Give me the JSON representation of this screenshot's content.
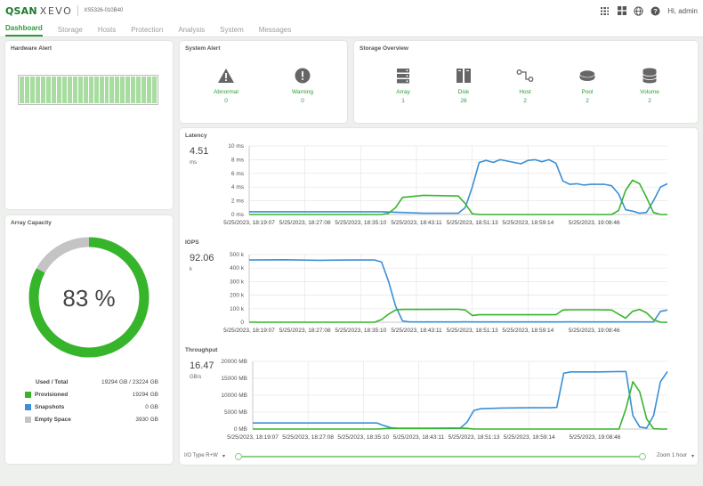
{
  "header": {
    "brand_main": "QSAN",
    "brand_sub": "XEVO",
    "model": "XS5326-010B40",
    "user_greeting": "Hi, admin",
    "icons": [
      "network-icon",
      "grid-icon",
      "globe-icon",
      "help-icon"
    ]
  },
  "nav": {
    "tabs": [
      {
        "label": "Dashboard",
        "active": true
      },
      {
        "label": "Storage",
        "active": false
      },
      {
        "label": "Hosts",
        "active": false
      },
      {
        "label": "Protection",
        "active": false
      },
      {
        "label": "Analysis",
        "active": false
      },
      {
        "label": "System",
        "active": false
      },
      {
        "label": "Messages",
        "active": false
      }
    ]
  },
  "hardware_alert": {
    "title": "Hardware Alert",
    "cell_count": 26
  },
  "system_alert": {
    "title": "System Alert",
    "items": [
      {
        "label": "Abnormal",
        "value": "0",
        "icon": "warning-triangle-icon"
      },
      {
        "label": "Warning",
        "value": "0",
        "icon": "alert-circle-icon"
      }
    ]
  },
  "storage_overview": {
    "title": "Storage Overview",
    "items": [
      {
        "label": "Array",
        "value": "1",
        "icon": "array-icon"
      },
      {
        "label": "Disk",
        "value": "26",
        "icon": "disk-icon"
      },
      {
        "label": "Host",
        "value": "2",
        "icon": "host-icon"
      },
      {
        "label": "Pool",
        "value": "2",
        "icon": "pool-icon"
      },
      {
        "label": "Volume",
        "value": "2",
        "icon": "volume-icon"
      }
    ]
  },
  "array_capacity": {
    "title": "Array Capacity",
    "percent_label": "83 %",
    "provisioned_fraction": 0.83,
    "used_total_label": "Used / Total",
    "used_total_value": "19294 GB / 23224 GB",
    "legend": [
      {
        "label": "Provisioned",
        "value": "19294 GB",
        "color": "#36b52b"
      },
      {
        "label": "Snapshots",
        "value": "0 GB",
        "color": "#3a8fd6"
      },
      {
        "label": "Empty Space",
        "value": "3930 GB",
        "color": "#c4c4c4"
      }
    ]
  },
  "colors": {
    "green": "#36b52b",
    "blue": "#3a8fd6",
    "accent": "#2d9b3a"
  },
  "metrics": {
    "latency": {
      "title": "Latency",
      "value": "4.51",
      "unit": "ms"
    },
    "iops": {
      "title": "IOPS",
      "value": "92.06",
      "unit": "k"
    },
    "throughput": {
      "title": "Throughput",
      "value": "16.47",
      "unit": "GB/s"
    }
  },
  "bottom": {
    "io_type": "I/O Type R+W",
    "zoom": "Zoom 1 hour"
  },
  "chart_data": [
    {
      "type": "line",
      "title": "Latency",
      "ylabel": "",
      "yticks": [
        "0 ms",
        "2 ms",
        "4 ms",
        "6 ms",
        "8 ms",
        "10 ms"
      ],
      "ylim": [
        0,
        10
      ],
      "xlim": [
        0,
        60
      ],
      "xticks": [
        {
          "x": 0,
          "label": "5/25/2023, 18:19:07"
        },
        {
          "x": 8,
          "label": "5/25/2023, 18:27:08"
        },
        {
          "x": 16,
          "label": "5/25/2023, 18:35:10"
        },
        {
          "x": 24,
          "label": "5/25/2023, 18:43:11"
        },
        {
          "x": 32,
          "label": "5/25/2023, 18:51:13"
        },
        {
          "x": 40,
          "label": "5/25/2023, 18:59:14"
        },
        {
          "x": 49.5,
          "label": "5/25/2023, 19:08:46"
        }
      ],
      "series": [
        {
          "color": "#3a8fd6",
          "x": [
            0,
            19,
            22,
            25,
            30,
            31,
            32,
            33,
            34,
            35,
            36,
            37,
            38,
            39,
            40,
            41,
            42,
            43,
            44,
            45,
            46,
            47,
            48,
            49,
            50,
            51,
            52,
            53,
            54,
            55,
            56,
            57,
            58,
            59,
            60
          ],
          "values": [
            0.4,
            0.4,
            0.3,
            0.2,
            0.2,
            1.0,
            4.0,
            7.6,
            7.9,
            7.6,
            8.0,
            7.8,
            7.6,
            7.4,
            7.9,
            8.0,
            7.7,
            8.0,
            7.5,
            4.9,
            4.4,
            4.5,
            4.3,
            4.4,
            4.4,
            4.4,
            4.2,
            3.0,
            0.7,
            0.5,
            0.2,
            0.3,
            2.0,
            4.0,
            4.5
          ]
        },
        {
          "color": "#36b52b",
          "x": [
            0,
            19,
            20,
            21,
            22,
            25,
            30,
            31,
            32,
            33,
            40,
            50,
            52,
            53,
            54,
            55,
            56,
            57,
            58,
            59,
            60
          ],
          "values": [
            0,
            0,
            0.2,
            1.0,
            2.5,
            2.8,
            2.7,
            1.6,
            0.1,
            0,
            0,
            0,
            0,
            0.6,
            3.5,
            5.0,
            4.5,
            2.5,
            0.3,
            0.0,
            0.0
          ]
        }
      ]
    },
    {
      "type": "line",
      "title": "IOPS",
      "ylabel": "",
      "yticks": [
        "0",
        "100 k",
        "200 k",
        "300 k",
        "400 k",
        "500 k"
      ],
      "ylim": [
        0,
        500
      ],
      "xlim": [
        0,
        60
      ],
      "xticks": [
        {
          "x": 0,
          "label": "5/25/2023, 18:19:07"
        },
        {
          "x": 8,
          "label": "5/25/2023, 18:27:08"
        },
        {
          "x": 16,
          "label": "5/25/2023, 18:35:10"
        },
        {
          "x": 24,
          "label": "5/25/2023, 18:43:11"
        },
        {
          "x": 32,
          "label": "5/25/2023, 18:51:13"
        },
        {
          "x": 40,
          "label": "5/25/2023, 18:59:14"
        },
        {
          "x": 49.5,
          "label": "5/25/2023, 19:08:46"
        }
      ],
      "series": [
        {
          "color": "#3a8fd6",
          "x": [
            0,
            5,
            10,
            15,
            18,
            19,
            20,
            21,
            22,
            23,
            25,
            30,
            31,
            32,
            34,
            36,
            38,
            40,
            42,
            44,
            45,
            46,
            48,
            50,
            51,
            52,
            53,
            54,
            55,
            56,
            57,
            58,
            59,
            60
          ],
          "values": [
            460,
            462,
            458,
            460,
            460,
            445,
            300,
            120,
            10,
            2,
            2,
            2,
            3,
            2,
            2,
            2,
            2,
            2,
            2,
            2,
            2,
            3,
            2,
            2,
            2,
            2,
            2,
            2,
            2,
            2,
            2,
            2,
            80,
            90
          ]
        },
        {
          "color": "#36b52b",
          "x": [
            0,
            18,
            19,
            20,
            21,
            22,
            23,
            25,
            30,
            31,
            32,
            33,
            35,
            40,
            44,
            45,
            46,
            50,
            52,
            53,
            54,
            55,
            56,
            57,
            58,
            59,
            60
          ],
          "values": [
            0,
            0,
            20,
            60,
            90,
            95,
            95,
            95,
            96,
            90,
            50,
            55,
            55,
            55,
            55,
            90,
            92,
            92,
            90,
            60,
            30,
            80,
            95,
            70,
            20,
            0,
            0
          ]
        }
      ]
    },
    {
      "type": "line",
      "title": "Throughput",
      "ylabel": "",
      "yticks": [
        "0 MB",
        "5000 MB",
        "10000 MB",
        "15000 MB",
        "20000 MB"
      ],
      "ylim": [
        0,
        20000
      ],
      "xlim": [
        0,
        60
      ],
      "xticks": [
        {
          "x": 0,
          "label": "5/25/2023, 18:19:07"
        },
        {
          "x": 8,
          "label": "5/25/2023, 18:27:08"
        },
        {
          "x": 16,
          "label": "5/25/2023, 18:35:10"
        },
        {
          "x": 24,
          "label": "5/25/2023, 18:43:11"
        },
        {
          "x": 32,
          "label": "5/25/2023, 18:51:13"
        },
        {
          "x": 40,
          "label": "5/25/2023, 18:59:14"
        },
        {
          "x": 49.5,
          "label": "5/25/2023, 19:08:46"
        }
      ],
      "series": [
        {
          "color": "#3a8fd6",
          "x": [
            0,
            18,
            19,
            20,
            21,
            25,
            30,
            31,
            32,
            33,
            36,
            40,
            43,
            44,
            45,
            46,
            50,
            53,
            54,
            55,
            56,
            57,
            58,
            59,
            60
          ],
          "values": [
            1800,
            1800,
            1000,
            400,
            200,
            200,
            200,
            2000,
            5500,
            6000,
            6200,
            6300,
            6300,
            6400,
            16500,
            16900,
            16900,
            17000,
            17000,
            4000,
            600,
            300,
            4000,
            14000,
            17000
          ]
        },
        {
          "color": "#36b52b",
          "x": [
            0,
            18,
            19,
            20,
            25,
            30,
            31,
            32,
            35,
            40,
            50,
            53,
            54,
            55,
            56,
            57,
            58,
            59,
            60
          ],
          "values": [
            0,
            0,
            100,
            200,
            200,
            300,
            200,
            0,
            0,
            0,
            0,
            0,
            6000,
            14000,
            11000,
            3000,
            100,
            0,
            0
          ]
        }
      ]
    }
  ]
}
